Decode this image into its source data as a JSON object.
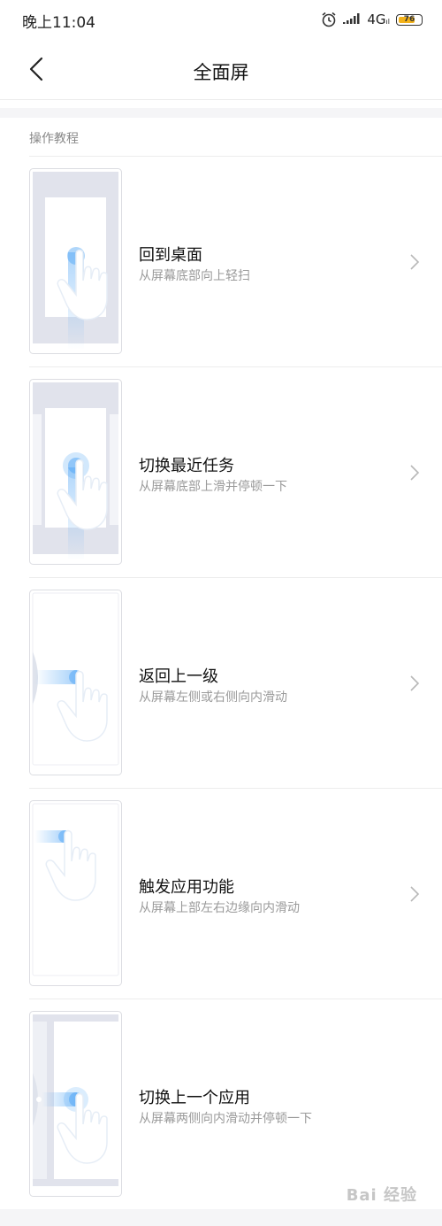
{
  "status_bar": {
    "time": "晚上11:04",
    "network": "4G",
    "network_sub": "ıl",
    "battery": "76"
  },
  "header": {
    "title": "全面屏"
  },
  "section": {
    "title": "操作教程"
  },
  "items": [
    {
      "title": "回到桌面",
      "subtitle": "从屏幕底部向上轻扫"
    },
    {
      "title": "切换最近任务",
      "subtitle": "从屏幕底部上滑并停顿一下"
    },
    {
      "title": "返回上一级",
      "subtitle": "从屏幕左侧或右侧向内滑动"
    },
    {
      "title": "触发应用功能",
      "subtitle": "从屏幕上部左右边缘向内滑动"
    },
    {
      "title": "切换上一个应用",
      "subtitle": "从屏幕两侧向内滑动并停顿一下"
    }
  ],
  "watermark": "Bai 经验",
  "colors": {
    "accent_blue": "#4da3f5",
    "battery": "#f3b21a",
    "divider": "#ececec"
  }
}
